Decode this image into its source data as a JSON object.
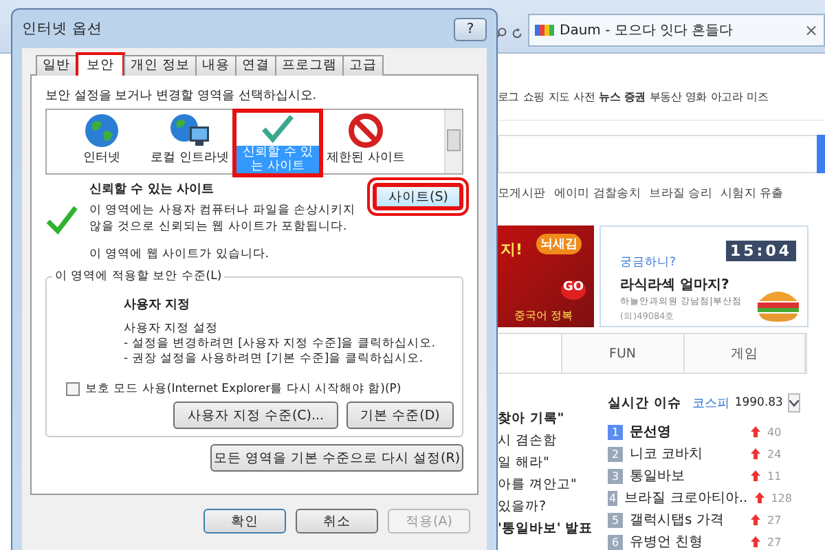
{
  "browser": {
    "tab_title": "Daum - 모으다 잇다 흔들다",
    "close_glyph": "×",
    "nav_links": [
      "로그",
      "쇼핑",
      "지도",
      "사전",
      "뉴스",
      "증권",
      "부동산",
      "영화",
      "아고라",
      "미즈"
    ],
    "issue_links": [
      "모게시판",
      "에이미 검찰송치",
      "브라질 승리",
      "시험지 유출"
    ],
    "ad_left": {
      "badge": "뇌새김",
      "title": "지!",
      "go": "GO",
      "caption": "중국어 정복"
    },
    "ad_right": {
      "clock": "15:04",
      "kicker": "궁금하니?",
      "title": "라식라섹 얼마지?",
      "sponsor": "하늘안과의원 강남점|부산점",
      "license": "(의)49084호"
    },
    "tabs": [
      {
        "label": "FUN",
        "selected": false
      },
      {
        "label": "게임",
        "selected": false
      }
    ],
    "news": [
      "찾아 기록\"",
      "시 겸손함",
      "일 해라\"",
      "아를 껴안고\"",
      "있을까?",
      "'통일바보' 발표"
    ],
    "issues": {
      "title": "실시간 이슈",
      "index_name": "코스피",
      "index_value": "1990.83",
      "ranks": [
        {
          "rank": "1",
          "name": "문선영",
          "change": "40",
          "highlighted": true
        },
        {
          "rank": "2",
          "name": "니코 코바치",
          "change": "24",
          "highlighted": false
        },
        {
          "rank": "3",
          "name": "통일바보",
          "change": "11",
          "highlighted": false
        },
        {
          "rank": "4",
          "name": "브라질 크로아티아..",
          "change": "128",
          "highlighted": false
        },
        {
          "rank": "5",
          "name": "갤럭시탭s 가격",
          "change": "27",
          "highlighted": false
        },
        {
          "rank": "6",
          "name": "유병언 친형",
          "change": "27",
          "highlighted": false
        }
      ]
    }
  },
  "dialog": {
    "title": "인터넷 옵션",
    "help_glyph": "?",
    "tabs": [
      {
        "label": "일반",
        "selected": false,
        "highlighted": false
      },
      {
        "label": "보안",
        "selected": true,
        "highlighted": true
      },
      {
        "label": "개인 정보",
        "selected": false,
        "highlighted": false
      },
      {
        "label": "내용",
        "selected": false,
        "highlighted": false
      },
      {
        "label": "연결",
        "selected": false,
        "highlighted": false
      },
      {
        "label": "프로그램",
        "selected": false,
        "highlighted": false
      },
      {
        "label": "고급",
        "selected": false,
        "highlighted": false
      }
    ],
    "zone_prompt": "보안 설정을 보거나 변경할 영역을 선택하십시오.",
    "zones": [
      {
        "kind": "globe",
        "label": "인터넷",
        "selected": false,
        "highlighted": false
      },
      {
        "kind": "intranet",
        "label": "로컬 인트라넷",
        "selected": false,
        "highlighted": false
      },
      {
        "kind": "trusted",
        "label": "신뢰할 수 있는 사이트",
        "selected": true,
        "highlighted": true
      },
      {
        "kind": "restricted",
        "label": "제한된 사이트",
        "selected": false,
        "highlighted": false
      }
    ],
    "zone_title": "신뢰할 수 있는 사이트",
    "zone_description": "이 영역에는 사용자 컴퓨터나 파일을 손상시키지 않을 것으로 신뢰되는 웹 사이트가 포함됩니다.",
    "zone_note": "이 영역에 웹 사이트가 있습니다.",
    "sites_button": {
      "label": "사이트(S)",
      "highlighted": true
    },
    "level_group": "이 영역에 적용할 보안 수준(L)",
    "level_title": "사용자 지정",
    "level_lines": [
      "사용자 지정 설정",
      "- 설정을 변경하려면 [사용자 지정 수준]을 클릭하십시오.",
      "- 권장 설정을 사용하려면 [기본 수준]을 클릭하십시오."
    ],
    "protected_mode": {
      "label": "보호 모드 사용(Internet Explorer를 다시 시작해야 함)(P)",
      "checked": false
    },
    "custom_level_button": "사용자 지정 수준(C)...",
    "default_level_button": "기본 수준(D)",
    "reset_button": "모든 영역을 기본 수준으로 다시 설정(R)",
    "footer_buttons": [
      {
        "label": "확인",
        "disabled": false
      },
      {
        "label": "취소",
        "disabled": false
      },
      {
        "label": "적용(A)",
        "disabled": true
      }
    ]
  }
}
